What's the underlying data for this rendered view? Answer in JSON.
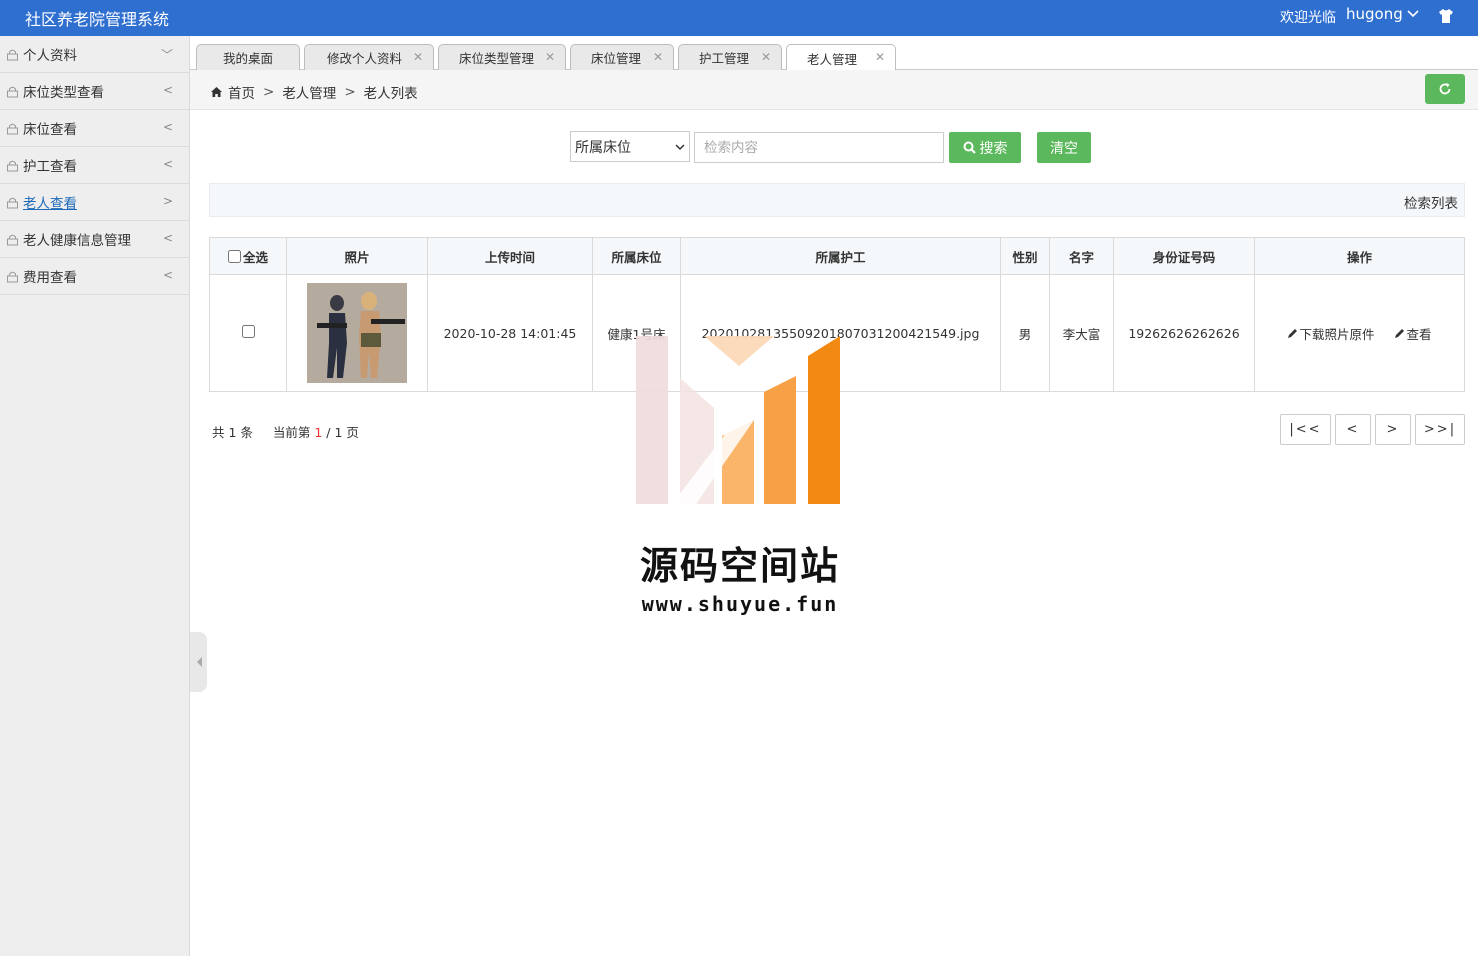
{
  "app": {
    "title": "社区养老院管理系统",
    "welcome": "欢迎光临",
    "username": "hugong"
  },
  "sidebar": {
    "items": [
      {
        "label": "个人资料",
        "arrow": "﹀"
      },
      {
        "label": "床位类型查看",
        "arrow": "<"
      },
      {
        "label": "床位查看",
        "arrow": "<"
      },
      {
        "label": "护工查看",
        "arrow": "<"
      },
      {
        "label": "老人查看",
        "arrow": ">"
      },
      {
        "label": "老人健康信息管理",
        "arrow": "<"
      },
      {
        "label": "费用查看",
        "arrow": "<"
      }
    ]
  },
  "tabs": [
    {
      "label": "我的桌面"
    },
    {
      "label": "修改个人资料"
    },
    {
      "label": "床位类型管理"
    },
    {
      "label": "床位管理"
    },
    {
      "label": "护工管理"
    },
    {
      "label": "老人管理"
    }
  ],
  "breadcrumb": {
    "home": "首页",
    "level1": "老人管理",
    "level2": "老人列表",
    "sep": ">"
  },
  "search": {
    "select_value": "所属床位",
    "placeholder": "检索内容",
    "search_label": "搜索",
    "clear_label": "清空"
  },
  "list_title": "检索列表",
  "table": {
    "select_all": "全选",
    "headers": [
      "照片",
      "上传时间",
      "所属床位",
      "所属护工",
      "性别",
      "名字",
      "身份证号码",
      "操作"
    ],
    "rows": [
      {
        "upload_time": "2020-10-28 14:01:45",
        "bed": "健康1号床",
        "nurse": "20201028135509201807031200421549.jpg",
        "gender": "男",
        "name": "李大富",
        "id_number": "19262626262626",
        "action_download": "下载照片原件",
        "action_view": "查看"
      }
    ]
  },
  "pagination": {
    "total_prefix": "共",
    "total": "1",
    "total_suffix": "条",
    "current_prefix": "当前第",
    "current": "1",
    "pages": "/ 1 页",
    "first": "|<<",
    "prev": "<",
    "next": ">",
    "last": ">>|"
  },
  "watermark": {
    "text": "源码空间站",
    "url": "www.shuyue.fun"
  },
  "colors": {
    "topbar": "#2f6fd0",
    "accent_green": "#5cb85c",
    "link_blue": "#1e6ab8"
  }
}
